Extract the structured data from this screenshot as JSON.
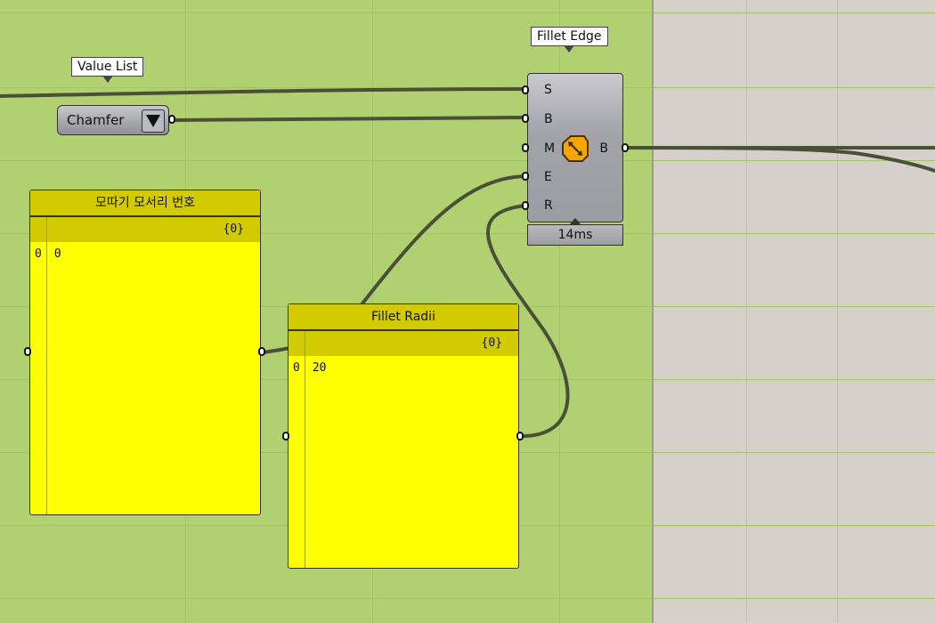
{
  "canvas": {
    "group_color": "#b1d072",
    "background_color": "#d5d1ca",
    "wire_color": "#4a5036",
    "panel_color": "#ffff00",
    "panel_header_color": "#d2cb00"
  },
  "value_list": {
    "tooltip": "Value List",
    "selected": "Chamfer"
  },
  "fillet_edge": {
    "tooltip": "Fillet Edge",
    "inputs": [
      "S",
      "B",
      "M",
      "E",
      "R"
    ],
    "output": "B",
    "icon": "fillet-edge-icon",
    "timing": "14ms"
  },
  "panels": [
    {
      "title": "모따기 모서리 번호",
      "branch": "{0}",
      "rows": [
        {
          "index": "0",
          "value": "0"
        }
      ]
    },
    {
      "title": "Fillet Radii",
      "branch": "{0}",
      "rows": [
        {
          "index": "0",
          "value": "20"
        }
      ]
    }
  ]
}
